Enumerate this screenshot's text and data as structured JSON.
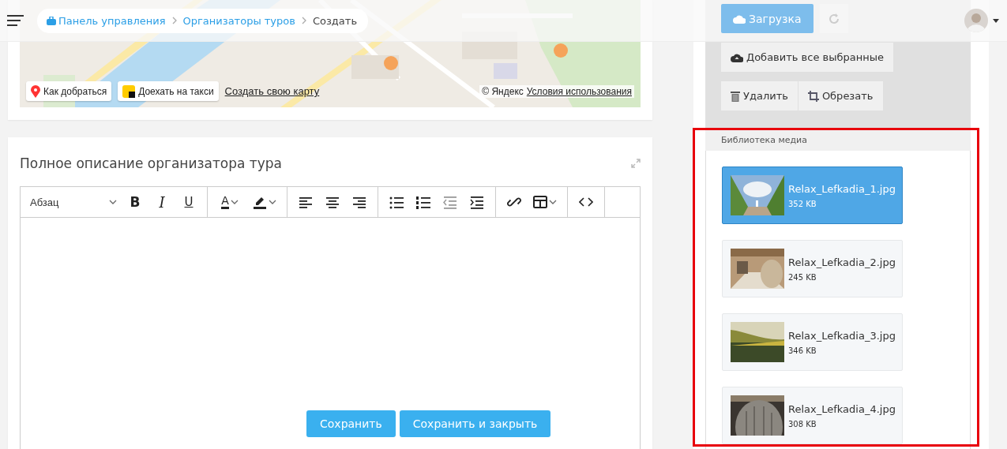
{
  "header": {
    "breadcrumbs": [
      {
        "label": "Панель управления",
        "kind": "home"
      },
      {
        "label": "Организаторы туров",
        "kind": "link"
      },
      {
        "label": "Создать",
        "kind": "current"
      }
    ],
    "upload_button": "Загрузка"
  },
  "map": {
    "route_button": "Как добраться",
    "taxi_button": "Доехать на такси",
    "create_map_link": "Создать свою карту",
    "copyright": "© Яндекс",
    "terms_link": "Условия использования"
  },
  "editor": {
    "title": "Полное описание организатора тура",
    "paragraph_select": "Абзац",
    "format_buttons": [
      "B",
      "I",
      "U"
    ],
    "text_color_label": "A",
    "buttons": [
      {
        "label": "Сохранить"
      },
      {
        "label": "Сохранить и закрыть"
      }
    ]
  },
  "media_actions": {
    "add_selected": "Добавить все выбранные",
    "delete": "Удалить",
    "crop": "Обрезать"
  },
  "media_library": {
    "title": "Библиотека медиа",
    "files": [
      {
        "name": "Relax_Lefkadia_1.jpg",
        "size": "352 KB",
        "selected": true
      },
      {
        "name": "Relax_Lefkadia_2.jpg",
        "size": "245 KB",
        "selected": false
      },
      {
        "name": "Relax_Lefkadia_3.jpg",
        "size": "346 KB",
        "selected": false
      },
      {
        "name": "Relax_Lefkadia_4.jpg",
        "size": "308 KB",
        "selected": false
      }
    ]
  }
}
